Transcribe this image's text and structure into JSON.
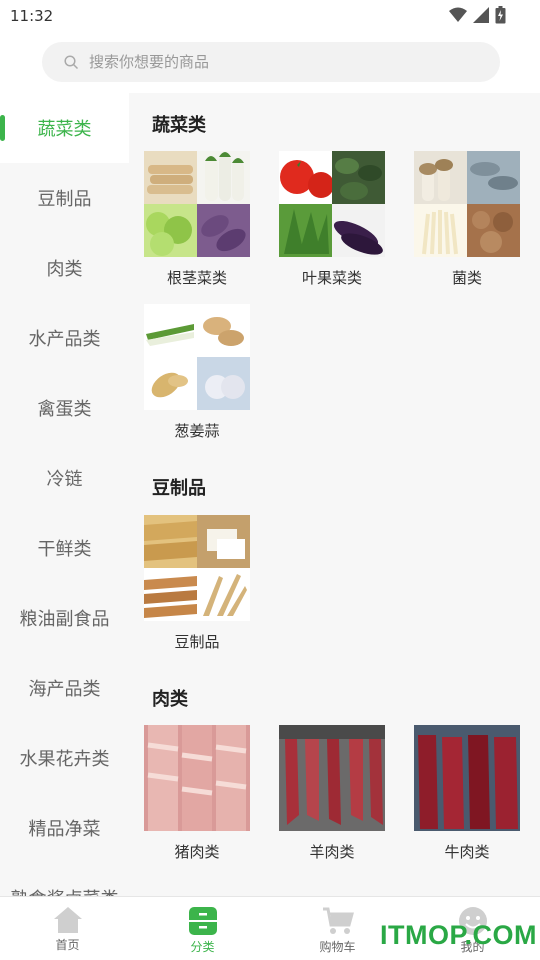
{
  "status_bar": {
    "time": "11:32"
  },
  "search": {
    "placeholder": "搜索你想要的商品"
  },
  "sidebar": {
    "items": [
      {
        "label": "蔬菜类",
        "active": true
      },
      {
        "label": "豆制品"
      },
      {
        "label": "肉类"
      },
      {
        "label": "水产品类"
      },
      {
        "label": "禽蛋类"
      },
      {
        "label": "冷链"
      },
      {
        "label": "干鲜类"
      },
      {
        "label": "粮油副食品"
      },
      {
        "label": "海产品类"
      },
      {
        "label": "水果花卉类"
      },
      {
        "label": "精品净菜"
      },
      {
        "label": "熟食酱卤菜类"
      }
    ]
  },
  "sections": [
    {
      "title": "蔬菜类",
      "categories": [
        {
          "label": "根茎菜类"
        },
        {
          "label": "叶果菜类"
        },
        {
          "label": "菌类"
        },
        {
          "label": "葱姜蒜"
        }
      ]
    },
    {
      "title": "豆制品",
      "categories": [
        {
          "label": "豆制品"
        }
      ]
    },
    {
      "title": "肉类",
      "categories": [
        {
          "label": "猪肉类"
        },
        {
          "label": "羊肉类"
        },
        {
          "label": "牛肉类"
        }
      ]
    }
  ],
  "bottom_nav": {
    "items": [
      {
        "label": "首页",
        "icon": "home-icon"
      },
      {
        "label": "分类",
        "icon": "category-icon",
        "active": true
      },
      {
        "label": "购物车",
        "icon": "cart-icon"
      },
      {
        "label": "我的",
        "icon": "profile-icon"
      }
    ]
  },
  "watermark": "ITMOP.COM",
  "colors": {
    "accent": "#3cb44b",
    "sidebar_bg": "#f7f7f7"
  }
}
